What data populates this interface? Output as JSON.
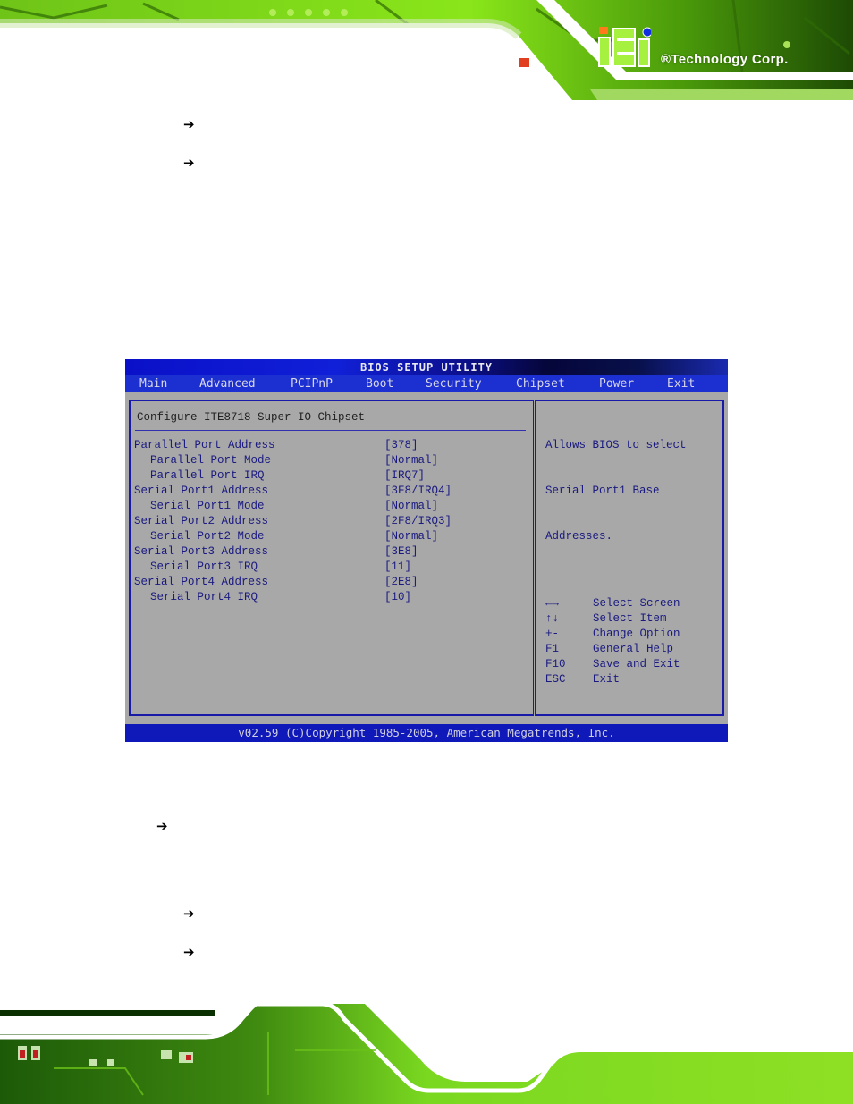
{
  "header": {
    "logo_text": "®Technology Corp."
  },
  "bullets_top": [
    "arrow-right",
    "arrow-right"
  ],
  "bullets_bottom": [
    "arrow-right",
    "arrow-right",
    "arrow-right"
  ],
  "bios": {
    "title": "BIOS SETUP UTILITY",
    "menu": [
      "Main",
      "Advanced",
      "PCIPnP",
      "Boot",
      "Security",
      "Chipset",
      "Power",
      "Exit"
    ],
    "active_menu": "Chipset",
    "section_title": "Configure ITE8718 Super IO Chipset",
    "settings": [
      {
        "label": "Parallel Port Address",
        "value": "[378]",
        "indent": false
      },
      {
        "label": "Parallel Port Mode",
        "value": "[Normal]",
        "indent": true
      },
      {
        "label": "Parallel Port IRQ",
        "value": "[IRQ7]",
        "indent": true
      },
      {
        "label": "Serial Port1 Address",
        "value": "[3F8/IRQ4]",
        "indent": false
      },
      {
        "label": "Serial Port1 Mode",
        "value": "[Normal]",
        "indent": true
      },
      {
        "label": "Serial Port2 Address",
        "value": "[2F8/IRQ3]",
        "indent": false
      },
      {
        "label": "Serial Port2 Mode",
        "value": "[Normal]",
        "indent": true
      },
      {
        "label": "Serial Port3 Address",
        "value": "[3E8]",
        "indent": false
      },
      {
        "label": "Serial Port3 IRQ",
        "value": "[11]",
        "indent": true
      },
      {
        "label": "Serial Port4 Address",
        "value": "[2E8]",
        "indent": false
      },
      {
        "label": "Serial Port4 IRQ",
        "value": "[10]",
        "indent": true
      }
    ],
    "help_lines": [
      "Allows BIOS to select",
      "Serial Port1 Base",
      "Addresses."
    ],
    "keys": [
      {
        "key": "←→",
        "desc": "Select Screen"
      },
      {
        "key": "↑↓",
        "desc": "Select Item"
      },
      {
        "key": "+-",
        "desc": "Change Option"
      },
      {
        "key": "F1",
        "desc": "General Help"
      },
      {
        "key": "F10",
        "desc": "Save and Exit"
      },
      {
        "key": "ESC",
        "desc": "Exit"
      }
    ],
    "footer": "v02.59 (C)Copyright 1985-2005, American Megatrends, Inc."
  },
  "colors": {
    "bios_bg": "#a8a8a8",
    "bios_text": "#1a1a80",
    "bios_bar": "#1c2fd0",
    "pcb_green": "#7de010"
  }
}
